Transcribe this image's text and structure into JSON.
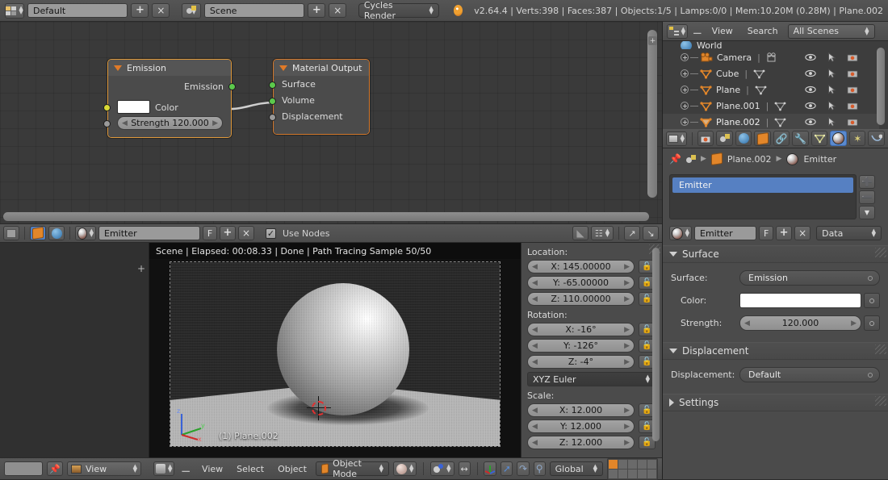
{
  "topbar": {
    "screen_layout": "Default",
    "scene_name": "Scene",
    "render_engine": "Cycles Render",
    "add_label": "+",
    "remove_label": "×",
    "stats": "v2.64.4 | Verts:398 | Faces:387 | Objects:1/5 | Lamps:0/0 | Mem:10.20M (0.28M) | Plane.002"
  },
  "node_editor": {
    "header": {
      "material_name": "Emitter",
      "fake_user_label": "F",
      "add_label": "+",
      "remove_label": "×",
      "use_nodes_label": "Use Nodes",
      "use_nodes_checked": "✓"
    },
    "nodes": [
      {
        "title": "Emission",
        "outputs": [
          "Emission"
        ],
        "color_label": "Color",
        "color_value": "#ffffff",
        "strength_label": "Strength",
        "strength_value": "120.000",
        "strength_display": "Strength 120.000",
        "selected": true
      },
      {
        "title": "Material Output",
        "inputs": [
          "Surface",
          "Volume",
          "Displacement"
        ],
        "selected": true
      }
    ]
  },
  "image_editor": {
    "status": "Scene | Elapsed: 00:08.33 | Done | Path Tracing Sample 50/50",
    "overlay_label": "(1) Plane.002",
    "footer": {
      "view_menu": "View"
    }
  },
  "transform_panel": {
    "location_label": "Location:",
    "location": [
      "X: 145.00000",
      "Y: -65.00000",
      "Z: 110.00000"
    ],
    "rotation_label": "Rotation:",
    "rotation": [
      "X: -16°",
      "Y: -126°",
      "Z: -4°"
    ],
    "rotation_mode": "XYZ Euler",
    "scale_label": "Scale:",
    "scale": [
      "X: 12.000",
      "Y: 12.000",
      "Z: 12.000"
    ]
  },
  "viewport_footer": {
    "menus": [
      "View",
      "Select",
      "Object"
    ],
    "mode": "Object Mode",
    "orientation": "Global"
  },
  "outliner": {
    "view_label": "View",
    "search_label": "Search",
    "display_mode": "All Scenes",
    "items": [
      {
        "name": "World",
        "type": "world",
        "active": false
      },
      {
        "name": "Camera",
        "type": "camera",
        "active": false
      },
      {
        "name": "Cube",
        "type": "mesh",
        "active": false
      },
      {
        "name": "Plane",
        "type": "mesh",
        "active": false
      },
      {
        "name": "Plane.001",
        "type": "mesh",
        "active": false
      },
      {
        "name": "Plane.002",
        "type": "mesh",
        "active": true
      }
    ]
  },
  "properties": {
    "tabs": [
      "render-tab",
      "scene-tab",
      "world-tab",
      "object-tab",
      "constraints-tab",
      "modifiers-tab",
      "data-tab",
      "material-tab",
      "particles-tab",
      "physics-tab"
    ],
    "active_tab": "material-tab",
    "breadcrumb": [
      "Plane.002",
      "Emitter"
    ],
    "material_slot": "Emitter",
    "slot_list": [
      "Emitter"
    ],
    "datablock": {
      "name": "Emitter",
      "fake_user_label": "F",
      "add_label": "+",
      "remove_label": "×",
      "link": "Data"
    },
    "surface_panel": {
      "title": "Surface",
      "expanded": true,
      "rows": [
        {
          "label": "Surface:",
          "value": "Emission",
          "kind": "dropdown"
        },
        {
          "label": "Color:",
          "value": "#ffffff",
          "kind": "color"
        },
        {
          "label": "Strength:",
          "value": "120.000",
          "kind": "number"
        }
      ]
    },
    "displacement_panel": {
      "title": "Displacement",
      "expanded": true,
      "rows": [
        {
          "label": "Displacement:",
          "value": "Default",
          "kind": "dropdown"
        }
      ]
    },
    "settings_panel": {
      "title": "Settings",
      "expanded": false
    }
  },
  "colors": {
    "accent_orange": "#e2862a",
    "select_blue": "#5680c2",
    "socket_green": "#5cc94c",
    "socket_yellow": "#d9d935",
    "socket_grey": "#9a9a9a"
  }
}
